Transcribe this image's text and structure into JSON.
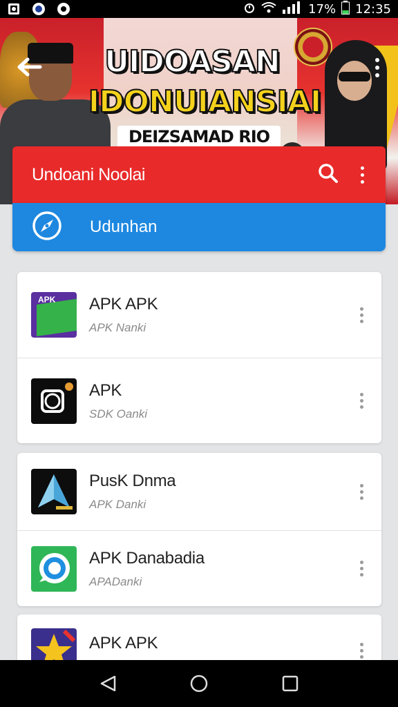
{
  "status_bar": {
    "battery": "17%",
    "time": "12:35"
  },
  "hero": {
    "title_line1": "UIDOASAN",
    "title_line2": "IDONUIANSIAI",
    "title_line3": "DEIZSAMAD RIO"
  },
  "app_bar": {
    "title": "Undoani Noolai",
    "subbar_label": "Udunhan"
  },
  "cards": [
    {
      "items": [
        {
          "title": "APK APK",
          "subtitle": "APK Nanki",
          "icon": "apk-green-purple-icon",
          "icon_text": "APK"
        },
        {
          "title": "APK",
          "subtitle": "SDK Oanki",
          "icon": "apk-black-icon"
        }
      ]
    },
    {
      "items": [
        {
          "title": "PusK Dnma",
          "subtitle": "APK Danki",
          "icon": "apk-arrow-icon"
        },
        {
          "title": "APK Danabadia",
          "subtitle": "APADanki",
          "icon": "apk-green-chat-icon"
        }
      ]
    },
    {
      "items": [
        {
          "title": "APK APK",
          "subtitle": "",
          "icon": "apk-star-icon"
        }
      ]
    }
  ],
  "colors": {
    "red_bar": "#e82a2a",
    "blue_bar": "#1e88e0",
    "background": "#e3e4e6"
  }
}
